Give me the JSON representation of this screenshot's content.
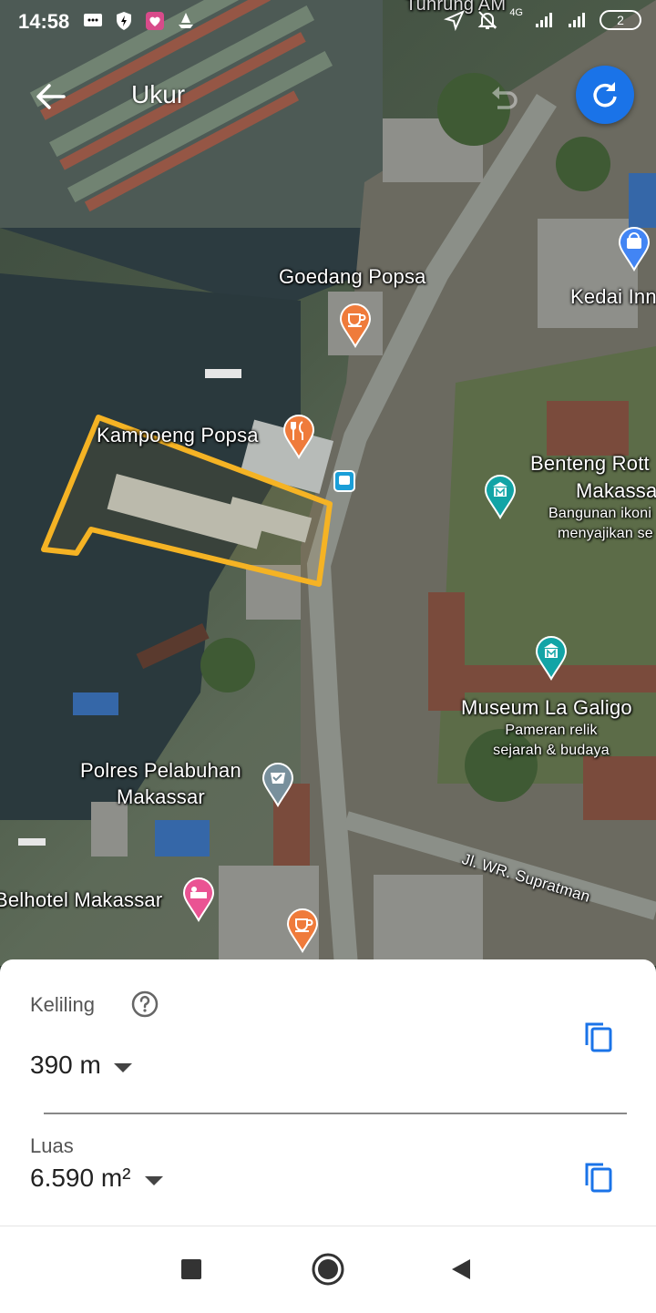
{
  "status_bar": {
    "time": "14:58",
    "network": "4G",
    "battery": "2"
  },
  "header": {
    "title": "Ukur"
  },
  "map": {
    "top_partial_label": "Tunrung AM",
    "labels": {
      "goedang": "Goedang Popsa",
      "kedai": "Kedai Inn",
      "kampoeng": "Kampoeng Popsa",
      "benteng_1": "Benteng Rott",
      "benteng_2": "Makassa",
      "benteng_desc_1": "Bangunan ikoni",
      "benteng_desc_2": "menyajikan se",
      "museum": "Museum La Galigo",
      "museum_desc_1": "Pameran relik",
      "museum_desc_2": "sejarah & budaya",
      "polres_1": "Polres Pelabuhan",
      "polres_2": "Makassar",
      "street": "Jl. WR. Supratman",
      "hotel": "Belhotel Makassar"
    },
    "colors": {
      "outline": "#f5b324",
      "pin_orange": "#ef7b3b",
      "pin_teal": "#12a4a6",
      "pin_blue": "#4285f4",
      "pin_pink": "#ea5393",
      "pin_gray": "#78909c"
    }
  },
  "measurement": {
    "perimeter_label": "Keliling",
    "perimeter_value": "390 m",
    "area_label": "Luas",
    "area_value": "6.590 m²"
  },
  "icons": {
    "back": "arrow-left-icon",
    "undo": "undo-icon",
    "refresh": "refresh-icon",
    "help": "help-circle-icon",
    "copy": "copy-icon",
    "nav_recents": "square-icon",
    "nav_home": "circle-icon",
    "nav_back": "triangle-back-icon"
  }
}
